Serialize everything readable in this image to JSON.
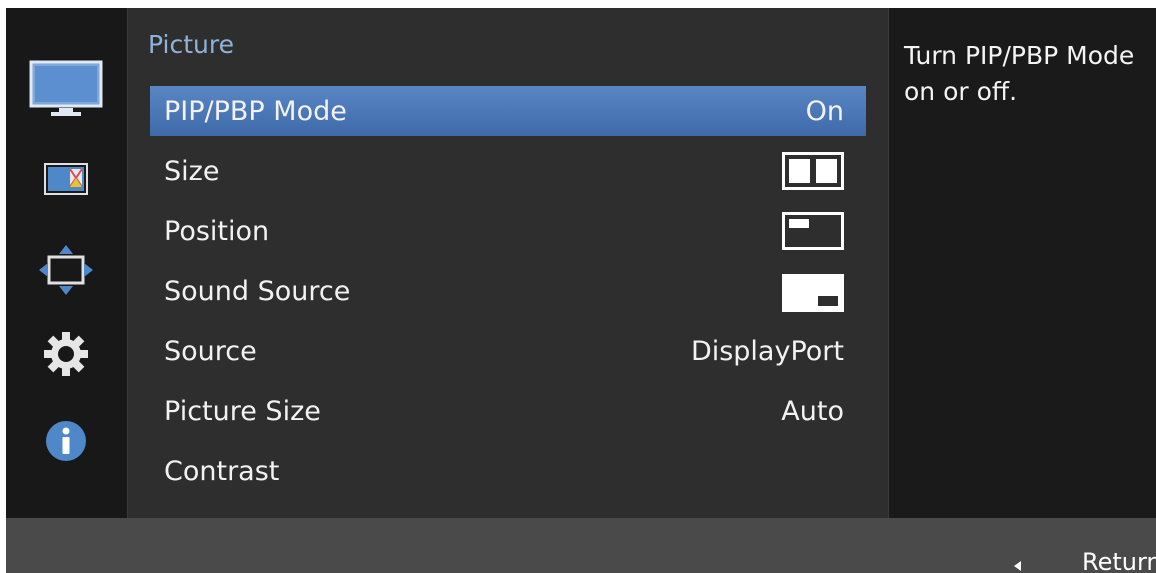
{
  "panel": {
    "title": "Picture",
    "items": [
      {
        "label": "PIP/PBP Mode",
        "value": "On",
        "selected": true
      },
      {
        "label": "Size",
        "value_icon": "pbp-split-icon"
      },
      {
        "label": "Position",
        "value_icon": "pip-top-left-icon"
      },
      {
        "label": "Sound Source",
        "value_icon": "pip-bottom-right-icon"
      },
      {
        "label": "Source",
        "value": "DisplayPort"
      },
      {
        "label": "Picture Size",
        "value": "Auto"
      },
      {
        "label": "Contrast",
        "value": ""
      }
    ]
  },
  "help": {
    "text": "Turn PIP/PBP Mode on or off."
  },
  "sidebar": {
    "icons": [
      "monitor-icon",
      "picture-color-icon",
      "resize-arrows-icon",
      "gear-icon",
      "info-icon"
    ]
  },
  "footer": {
    "return_label": "Return"
  },
  "colors": {
    "accent": "#4a78b8",
    "title": "#8fb2d9",
    "panel_bg": "#2e2e2e",
    "osd_bg": "#1a1a1a"
  }
}
